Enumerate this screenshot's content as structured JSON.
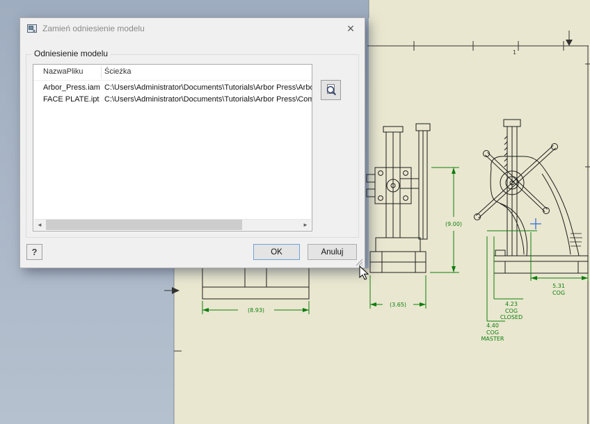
{
  "app": {
    "colors": {
      "background_top": "#9fadc0",
      "background_bottom": "#b6c1cf",
      "sheet": "#e9e7cf",
      "drawing_line": "#1c1c1c",
      "dimension_green": "#0e7d0e",
      "cog_blue": "#3b6fd4"
    }
  },
  "dialog": {
    "title": "Zamień odniesienie modelu",
    "group_label": "Odniesienie modelu",
    "table": {
      "columns": [
        "NazwaPliku",
        "Ścieżka"
      ],
      "rows": [
        {
          "name": "Arbor_Press.iam",
          "path": "C:\\Users\\Administrator\\Documents\\Tutorials\\Arbor Press\\Arbo"
        },
        {
          "name": "FACE PLATE.ipt",
          "path": "C:\\Users\\Administrator\\Documents\\Tutorials\\Arbor Press\\Com"
        }
      ]
    },
    "buttons": {
      "ok": "OK",
      "cancel": "Anuluj",
      "help": "?"
    },
    "icons": {
      "close": "✕",
      "scroll_left": "◄",
      "scroll_right": "►"
    }
  },
  "canvas": {
    "zone_label": "1",
    "dims": {
      "width_total": "(8.93)",
      "width_base": "(3.65)",
      "height_total": "(9.00)",
      "cog_531": [
        "5.31",
        "COG"
      ],
      "cog_423": [
        "4.23",
        "COG",
        "CLOSED"
      ],
      "cog_440": [
        "4.40",
        "COG",
        "MASTER"
      ]
    }
  }
}
